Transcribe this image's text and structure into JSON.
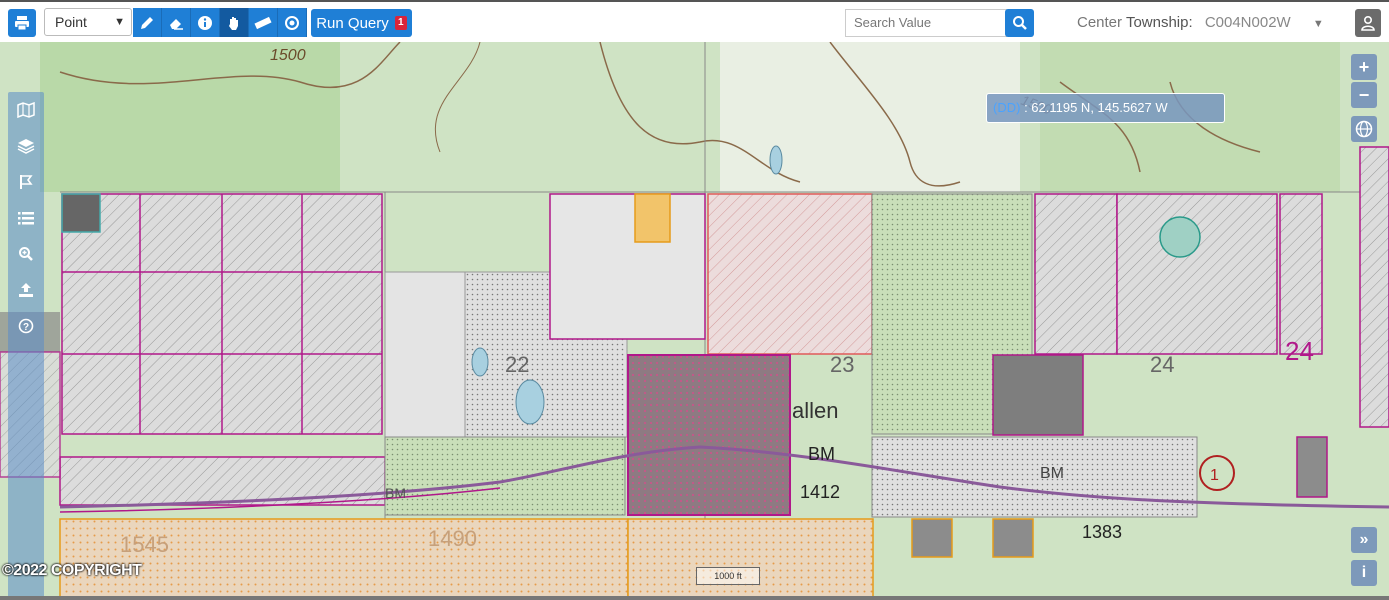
{
  "toolbar": {
    "draw_mode_value": "Point",
    "run_query_label": "Run Query",
    "run_query_count": "1",
    "search_placeholder": "Search Value",
    "township_label_prefix": "Center",
    "township_label_main": "Township:",
    "township_value": "C004N002W",
    "icons": [
      "print-icon",
      "pencil-icon",
      "eraser-icon",
      "info-icon",
      "hand-icon",
      "measure-icon",
      "target-icon",
      "search-icon",
      "user-icon"
    ]
  },
  "sidebar": {
    "items": [
      "map-icon",
      "layers-icon",
      "flag-icon",
      "list-icon",
      "zoom-icon",
      "upload-icon",
      "help-icon"
    ]
  },
  "coordinates": {
    "system": "(DD)",
    "value": ": 62.1195 N, 145.5627 W"
  },
  "map": {
    "section_numbers": [
      "22",
      "23",
      "24",
      "24"
    ],
    "place_name": "allen",
    "benchmarks": [
      "BM",
      "1412",
      "BM",
      "BM",
      "1383"
    ],
    "contours": [
      "1500",
      "1545",
      "1490",
      "1500"
    ],
    "copyright": "©2022 COPYRIGHT",
    "scale_label": "1000 ft"
  },
  "controls": {
    "zoom_in": "+",
    "zoom_out": "−",
    "expand": "»",
    "info": "i"
  }
}
